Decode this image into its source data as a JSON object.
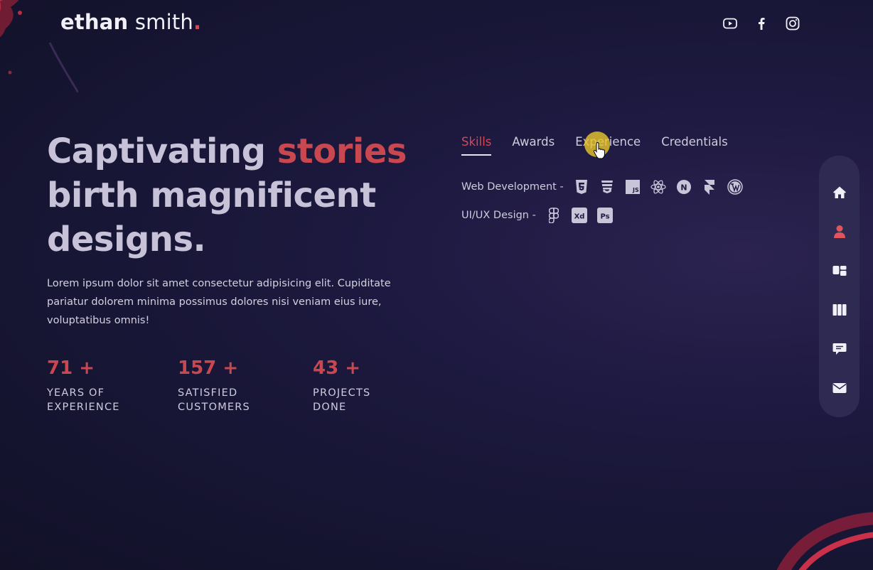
{
  "brand": {
    "first": "ethan",
    "last": "smith",
    "dot": "."
  },
  "socials": [
    {
      "icon": "youtube-icon"
    },
    {
      "icon": "facebook-icon"
    },
    {
      "icon": "instagram-icon"
    }
  ],
  "hero": {
    "headline_pre": "Captivating",
    "headline_accent": "stories",
    "headline_post": "birth magnificent designs.",
    "description": "Lorem ipsum dolor sit amet consectetur adipisicing elit. Cupiditate pariatur dolorem minima possimus dolores nisi veniam eius iure, voluptatibus omnis!"
  },
  "stats": [
    {
      "number": "71 +",
      "line1": "YEARS OF",
      "line2": "EXPERIENCE"
    },
    {
      "number": "157 +",
      "line1": "SATISFIED",
      "line2": "CUSTOMERS"
    },
    {
      "number": "43 +",
      "line1": "PROJECTS",
      "line2": "DONE"
    }
  ],
  "tabs": [
    {
      "label": "Skills",
      "active": true
    },
    {
      "label": "Awards",
      "active": false
    },
    {
      "label": "Experience",
      "active": false
    },
    {
      "label": "Credentials",
      "active": false
    }
  ],
  "skills": [
    {
      "label": "Web Development  -",
      "icons": [
        "html5-icon",
        "css3-icon",
        "javascript-icon",
        "react-icon",
        "nextjs-icon",
        "framer-icon",
        "wordpress-icon"
      ]
    },
    {
      "label": "UI/UX Design  -",
      "icons": [
        "figma-icon",
        "adobe-xd-icon",
        "photoshop-icon"
      ]
    }
  ],
  "side_nav": [
    {
      "icon": "home-icon",
      "active": false
    },
    {
      "icon": "user-icon",
      "active": true
    },
    {
      "icon": "services-icon",
      "active": false
    },
    {
      "icon": "portfolio-icon",
      "active": false
    },
    {
      "icon": "testimonials-icon",
      "active": false
    },
    {
      "icon": "contact-icon",
      "active": false
    }
  ],
  "colors": {
    "accent": "#c9474f",
    "background": "#1d1940",
    "nav_bg": "#2f2a52",
    "cursor_highlight": "#e6c42c"
  }
}
